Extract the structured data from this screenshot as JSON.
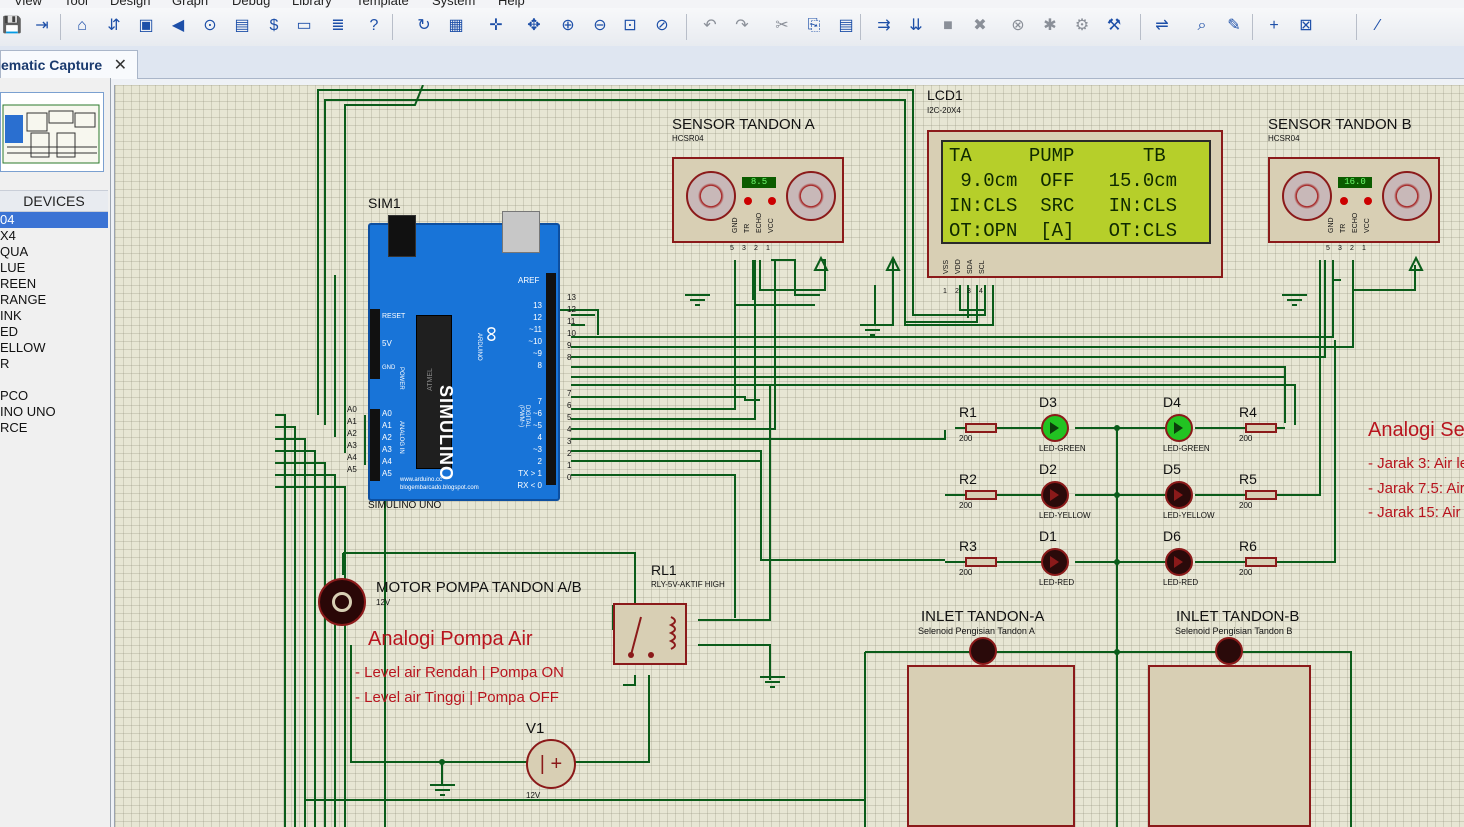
{
  "menubar": {
    "items": [
      "View",
      "Tool",
      "Design",
      "Graph",
      "Debug",
      "Library",
      "Template",
      "System",
      "Help"
    ]
  },
  "toolbar": {
    "icons": [
      "save-icon",
      "import-icon",
      "home-icon",
      "pick-icon",
      "chip-icon",
      "back-icon",
      "zoom-icon",
      "page-icon",
      "dollar-icon",
      "counter-icon",
      "doc-icon",
      "help-icon",
      "refresh-icon",
      "grid-icon",
      "origin-icon",
      "pan-icon",
      "zoom-in-icon",
      "zoom-out-icon",
      "zoom-all-icon",
      "zoom-area-icon",
      "undo-icon",
      "redo-icon",
      "cut-icon",
      "copy-icon",
      "paste-icon",
      "block-copy-icon",
      "block-move-icon",
      "block-rotate-icon",
      "block-delete-icon",
      "pick-device-icon",
      "make-device-icon",
      "package-icon",
      "decompose-icon",
      "wire-autorouter-icon",
      "search-icon",
      "property-tool-icon",
      "new-sheet-icon",
      "delete-sheet-icon",
      "netlist-icon"
    ]
  },
  "tab": {
    "label": "ematic Capture",
    "close": "✕"
  },
  "devices": {
    "header": "DEVICES",
    "items": [
      "04",
      "X4",
      "QUA",
      "LUE",
      "REEN",
      "RANGE",
      "INK",
      "ED",
      "ELLOW",
      "R",
      "",
      "PCO",
      "INO UNO",
      "RCE"
    ],
    "selected_index": 0
  },
  "schematic": {
    "arduino": {
      "ref": "SIM1",
      "name": "SIMULINO UNO",
      "brand": "SIMULINO",
      "sub": "ARDUINO",
      "url1": "www.arduino.cc",
      "url2": "blogembarcado.blogspot.com",
      "aref": "AREF",
      "digital_pins": [
        "13",
        "12",
        "~11",
        "~10",
        "~9",
        "8",
        "7",
        "~6",
        "~5",
        "4",
        "~3",
        "2",
        "TX > 1",
        "RX < 0"
      ],
      "right_nums": [
        "13",
        "12",
        "11",
        "10",
        "9",
        "8",
        "7",
        "6",
        "5",
        "4",
        "3",
        "2",
        "1",
        "0"
      ],
      "analog_pins": [
        "A0",
        "A1",
        "A2",
        "A3",
        "A4",
        "A5"
      ],
      "reset": "RESET",
      "v5": "5V",
      "gnd": "GND",
      "power": "POWER",
      "analog_in": "ANALOG IN",
      "digital": "DIGITAL (PWM~)",
      "chip": "ATMEL"
    },
    "sensor_a": {
      "title": "SENSOR TANDON A",
      "model": "HCSR04",
      "reading": "8.5",
      "pins": [
        "GND",
        "TR",
        "ECHO",
        "VCC"
      ],
      "pin_nums": [
        "5",
        "3",
        "2",
        "1"
      ]
    },
    "sensor_b": {
      "title": "SENSOR TANDON B",
      "model": "HCSR04",
      "reading": "16.0",
      "pins": [
        "GND",
        "TR",
        "ECHO",
        "VCC"
      ],
      "pin_nums": [
        "5",
        "3",
        "2",
        "1"
      ]
    },
    "lcd": {
      "ref": "LCD1",
      "model": "I2C-20X4",
      "lines": [
        "TA     PUMP      TB",
        " 9.0cm  OFF   15.0cm",
        "IN:CLS  SRC   IN:CLS",
        "OT:OPN  [A]   OT:CLS"
      ],
      "pins": [
        "VSS",
        "VDD",
        "SDA",
        "SCL"
      ],
      "pin_nums": [
        "1",
        "2",
        "3",
        "4"
      ]
    },
    "resistors": [
      {
        "ref": "R1",
        "value": "200"
      },
      {
        "ref": "R2",
        "value": "200"
      },
      {
        "ref": "R3",
        "value": "200"
      },
      {
        "ref": "R4",
        "value": "200"
      },
      {
        "ref": "R5",
        "value": "200"
      },
      {
        "ref": "R6",
        "value": "200"
      }
    ],
    "leds": [
      {
        "ref": "D3",
        "type": "LED-GREEN",
        "color": "#22c322"
      },
      {
        "ref": "D4",
        "type": "LED-GREEN",
        "color": "#22c322"
      },
      {
        "ref": "D2",
        "type": "LED-YELLOW",
        "color": "#2a0a0a"
      },
      {
        "ref": "D5",
        "type": "LED-YELLOW",
        "color": "#2a0a0a"
      },
      {
        "ref": "D1",
        "type": "LED-RED",
        "color": "#2a0a0a"
      },
      {
        "ref": "D6",
        "type": "LED-RED",
        "color": "#2a0a0a"
      }
    ],
    "motor": {
      "title": "MOTOR POMPA TANDON A/B",
      "voltage": "12V"
    },
    "relay": {
      "ref": "RL1",
      "model": "RLY-5V-AKTIF HIGH"
    },
    "v1": {
      "ref": "V1",
      "voltage": "12V"
    },
    "pump_note": {
      "title": "Analogi Pompa Air",
      "lines": [
        "- Level air Rendah | Pompa ON",
        "- Level air Tinggi | Pompa OFF"
      ]
    },
    "sensor_note": {
      "title": "Analogi Se",
      "lines": [
        "- Jarak 3: Air le",
        "- Jarak 7.5: Air",
        "- Jarak 15: Air"
      ]
    },
    "inlet_a": {
      "title": "INLET TANDON-A",
      "sub": "Selenoid Pengisian Tandon A"
    },
    "inlet_b": {
      "title": "INLET TANDON-B",
      "sub": "Selenoid Pengisian Tandon B"
    }
  },
  "colors": {
    "wire": "#0a5c1a",
    "outline": "#8b1a1a",
    "body": "#d8cfb4",
    "note": "#b8141e",
    "lcd_bg": "#b6cf2a",
    "lcd_text": "#0f2a00",
    "arduino": "#1874d8"
  }
}
